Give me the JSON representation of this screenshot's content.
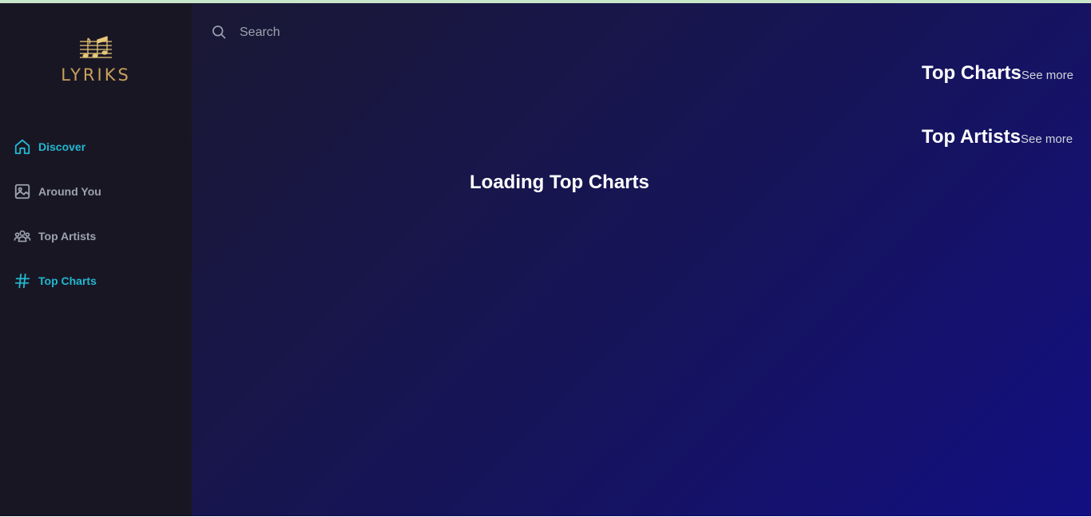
{
  "app": {
    "brand": "LYRIKS"
  },
  "sidebar": {
    "items": [
      {
        "label": "Discover",
        "icon": "home-icon",
        "active": true
      },
      {
        "label": "Around You",
        "icon": "image-icon",
        "active": false
      },
      {
        "label": "Top Artists",
        "icon": "users-icon",
        "active": false
      },
      {
        "label": "Top Charts",
        "icon": "hash-icon",
        "active": true
      }
    ]
  },
  "search": {
    "placeholder": "Search",
    "value": ""
  },
  "right_panel": {
    "top_charts": {
      "title": "Top Charts",
      "see_more": "See more"
    },
    "top_artists": {
      "title": "Top Artists",
      "see_more": "See more"
    }
  },
  "main": {
    "loading_text": "Loading Top Charts"
  },
  "colors": {
    "accent": "#22b8cf",
    "sidebar_bg": "#191624",
    "nav_idle": "#9ca3af",
    "logo_gold": "#c9a05a",
    "main_gradient_start": "#1a1833",
    "main_gradient_end": "#120f82"
  }
}
